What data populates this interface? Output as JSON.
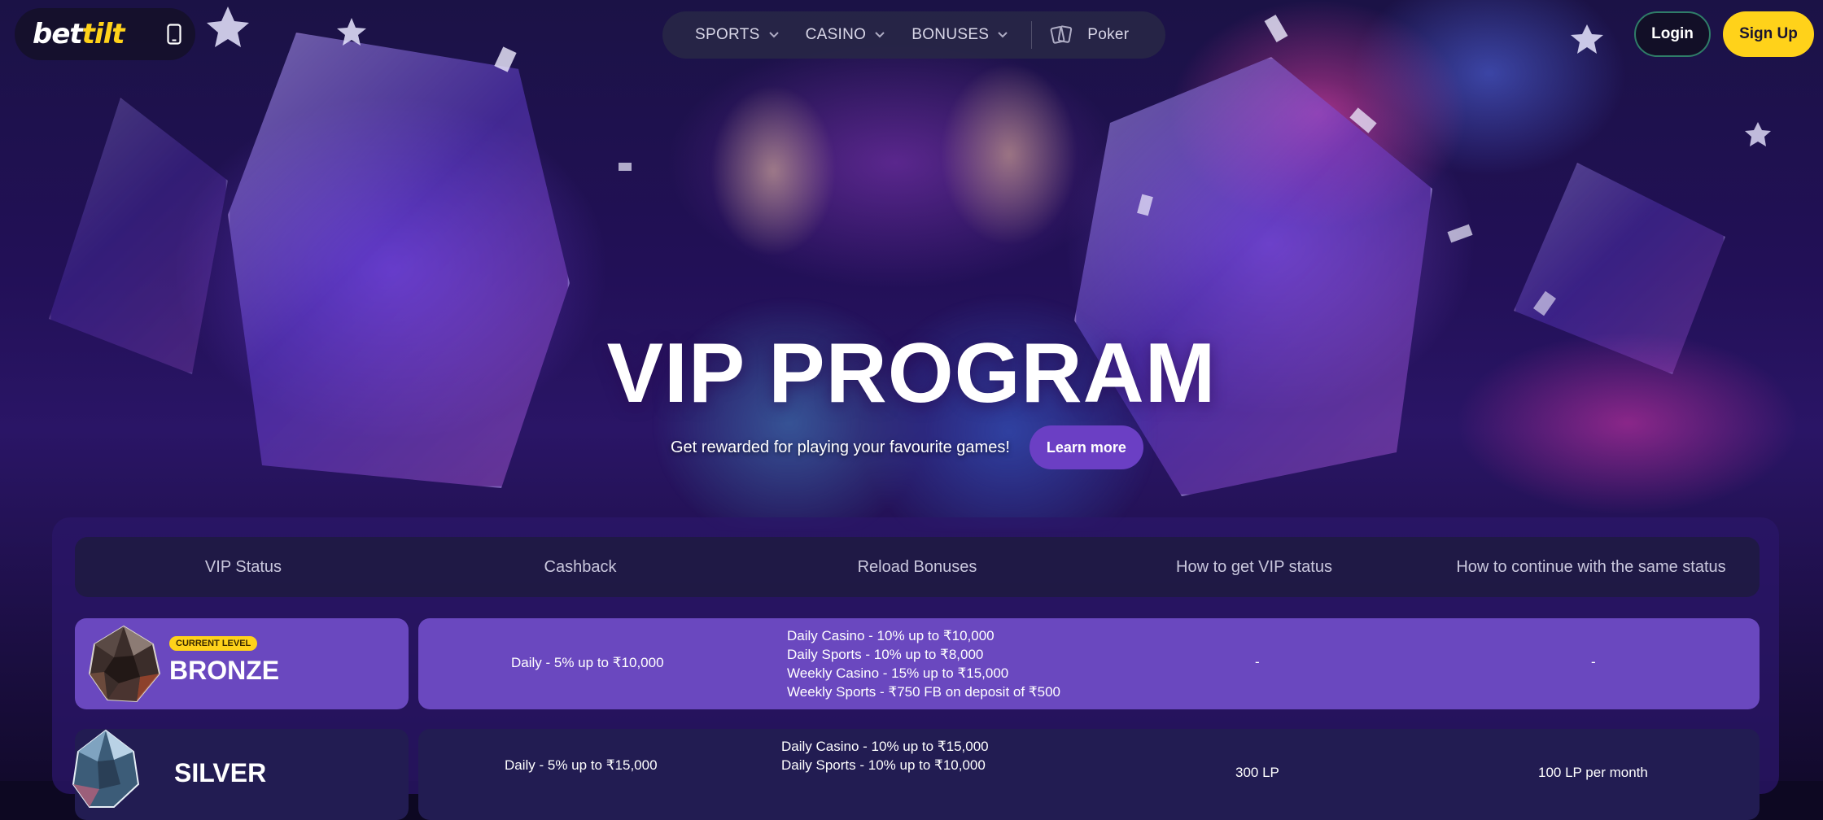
{
  "brand": {
    "logo_white": "bet",
    "logo_yellow": "tilt"
  },
  "nav": {
    "items": [
      {
        "label": "SPORTS",
        "icon": "chevron-down-icon"
      },
      {
        "label": "CASINO",
        "icon": "chevron-down-icon"
      },
      {
        "label": "BONUSES",
        "icon": "chevron-down-icon"
      }
    ],
    "poker": {
      "label": "Poker",
      "icon": "cards-icon"
    }
  },
  "auth": {
    "login_label": "Login",
    "signup_label": "Sign Up"
  },
  "hero": {
    "title": "VIP PROGRAM",
    "subtitle": "Get rewarded for playing your favourite games!",
    "cta_label": "Learn more"
  },
  "colors": {
    "accent_yellow": "#ffd21a",
    "accent_purple": "#6b3fc4",
    "bronze_row": "#6a48bf",
    "silver_row": "#221c52"
  },
  "table": {
    "headers": [
      "VIP Status",
      "Cashback",
      "Reload Bonuses",
      "How to get VIP status",
      "How to continue with the same status"
    ],
    "rows": [
      {
        "level": "BRONZE",
        "badge": "CURRENT LEVEL",
        "cashback": "Daily - 5% up to ₹10,000",
        "reload": [
          "Daily Casino - 10% up to ₹10,000",
          "Daily Sports - 10% up to ₹8,000",
          "Weekly Casino - 15% up to ₹15,000",
          "Weekly Sports - ₹750 FB on deposit of ₹500"
        ],
        "how_to_get": "-",
        "how_to_keep": "-"
      },
      {
        "level": "SILVER",
        "cashback": "Daily - 5% up to ₹15,000",
        "reload": [
          "Daily Casino - 10% up to ₹15,000",
          "Daily Sports - 10% up to ₹10,000"
        ],
        "how_to_get": "300 LP",
        "how_to_keep": "100 LP per month"
      }
    ]
  }
}
